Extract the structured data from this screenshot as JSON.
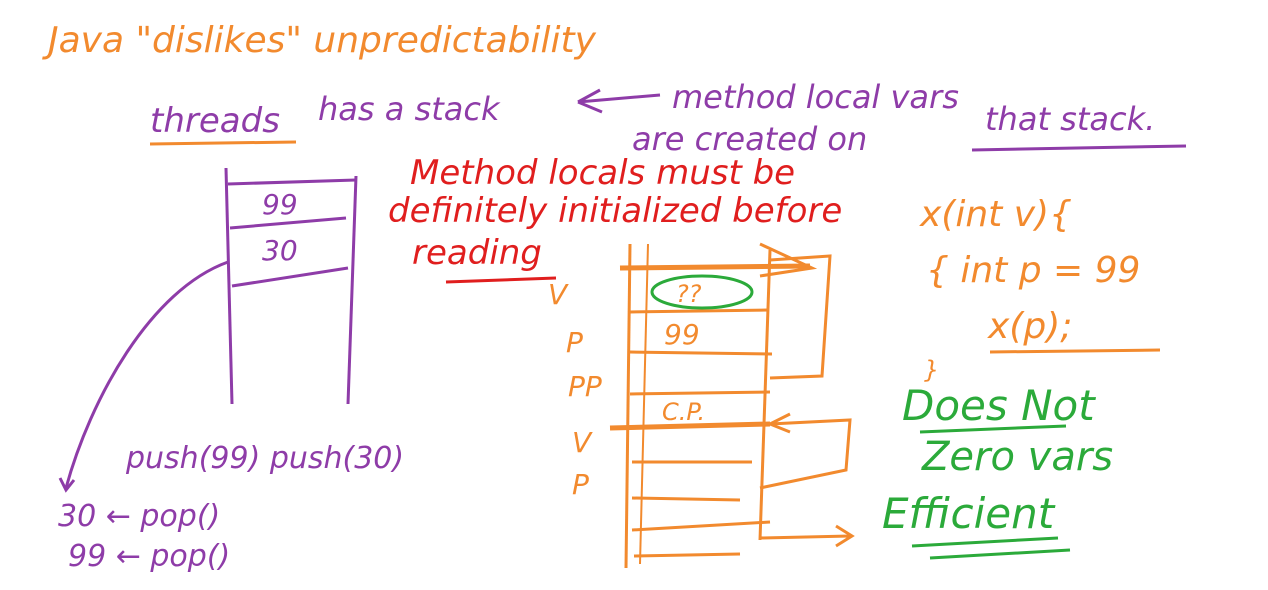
{
  "colors": {
    "orange": "#F28A2E",
    "purple": "#8E3CA8",
    "red": "#E01E1E",
    "green": "#2BAA3A"
  },
  "title": "Java \"dislikes\" unpredictability",
  "thread_line": {
    "word": "threads",
    "rest": "has a stack",
    "method_local": "method local vars",
    "are_created": "are created on",
    "that_stack": "that stack."
  },
  "red_note": {
    "line1": "Method locals must be",
    "line2": "definitely initialized before",
    "line3": "reading"
  },
  "left_stack": {
    "cells": [
      "99",
      "30"
    ],
    "push_ops": "push(99) push(30)",
    "pop_lines": [
      "30 ← pop()",
      "99 ← pop()"
    ]
  },
  "orange_stack": {
    "cells": [
      "??",
      "99",
      "",
      "C.P.",
      "",
      "",
      ""
    ],
    "side_labels": [
      "V",
      "P",
      "PP",
      "V",
      "P"
    ]
  },
  "code": {
    "line1": "x(int v){",
    "line2": "{ int p = 99",
    "line3": "x(p);",
    "line4": "}"
  },
  "green_note": {
    "line1": "Does Not",
    "line2": "Zero vars",
    "line3": "Efficient"
  }
}
